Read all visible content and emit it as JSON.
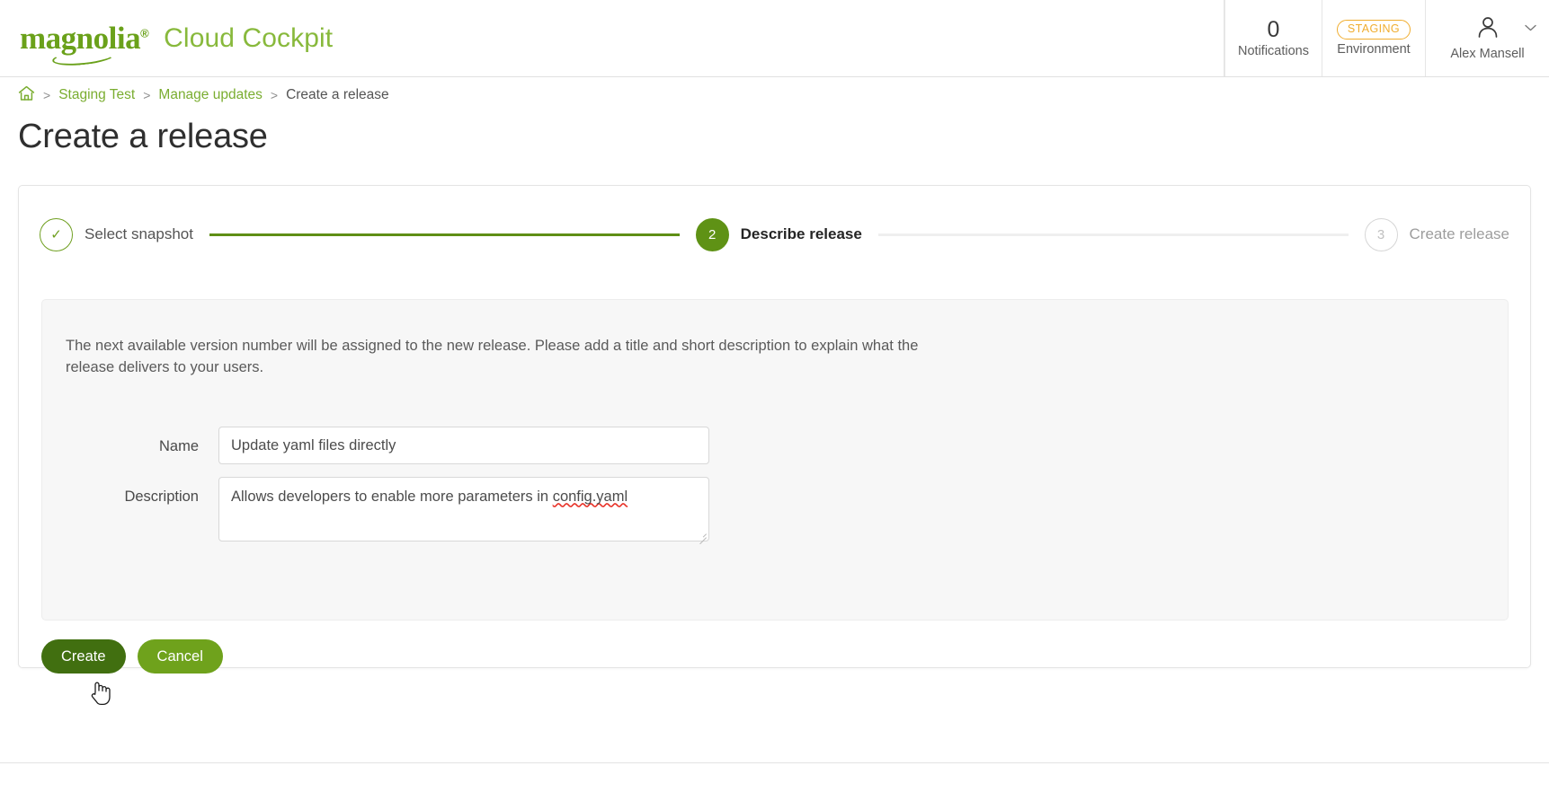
{
  "header": {
    "logo_text": "magnolia",
    "logo_registered": "®",
    "app_title": "Cloud Cockpit",
    "notifications": {
      "count": "0",
      "label": "Notifications",
      "icon": "notifications-icon"
    },
    "environment": {
      "badge": "STAGING",
      "label": "Environment"
    },
    "user": {
      "name": "Alex Mansell",
      "avatar_icon": "user-avatar-icon",
      "caret_icon": "chevron-down-icon"
    }
  },
  "breadcrumb": {
    "home_icon": "home-icon",
    "separator": ">",
    "items": [
      {
        "label": "Staging Test",
        "current": false
      },
      {
        "label": "Manage updates",
        "current": false
      },
      {
        "label": "Create a release",
        "current": true
      }
    ]
  },
  "page": {
    "title": "Create a release"
  },
  "stepper": {
    "steps": [
      {
        "marker": "✓",
        "label": "Select snapshot",
        "state": "done"
      },
      {
        "marker": "2",
        "label": "Describe release",
        "state": "active"
      },
      {
        "marker": "3",
        "label": "Create release",
        "state": "todo"
      }
    ]
  },
  "panel": {
    "intro": "The next available version number will be assigned to the new release. Please add a title and short description to explain what the release delivers to your users.",
    "form": {
      "name": {
        "label": "Name",
        "value": "Update yaml files directly",
        "placeholder": ""
      },
      "description": {
        "label": "Description",
        "value_before": "Allows developers to enable more parameters in ",
        "value_misspelled": "config.yaml",
        "value": "Allows developers to enable more parameters in config.yaml",
        "placeholder": ""
      }
    }
  },
  "actions": {
    "create_label": "Create",
    "cancel_label": "Cancel"
  },
  "colors": {
    "brand_green": "#6aa11a",
    "app_title_green": "#88b93c",
    "step_active": "#5f9215",
    "connector_filled": "#5f8f15",
    "connector_empty": "#efefef",
    "staging_amber": "#f0ad2e",
    "btn_create": "#416f10",
    "btn_cancel": "#6fa21c",
    "panel_bg": "#f7f7f7",
    "spellcheck_red": "#e8342a"
  }
}
